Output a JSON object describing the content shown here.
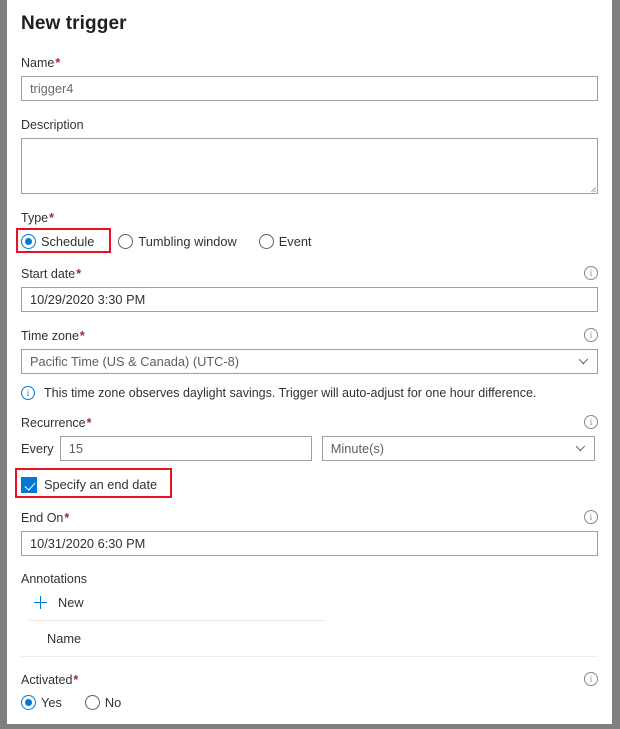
{
  "panel": {
    "title": "New trigger"
  },
  "fields": {
    "name": {
      "label": "Name",
      "required": "*",
      "value": "trigger4"
    },
    "description": {
      "label": "Description",
      "value": ""
    },
    "type": {
      "label": "Type",
      "required": "*",
      "options": [
        {
          "label": "Schedule",
          "selected": true,
          "highlighted": true
        },
        {
          "label": "Tumbling window",
          "selected": false,
          "highlighted": false
        },
        {
          "label": "Event",
          "selected": false,
          "highlighted": false
        }
      ]
    },
    "start_date": {
      "label": "Start date",
      "required": "*",
      "value": "10/29/2020 3:30 PM",
      "info_icon": "info-icon"
    },
    "time_zone": {
      "label": "Time zone",
      "required": "*",
      "value": "Pacific Time (US & Canada) (UTC-8)",
      "info_icon": "info-icon",
      "chevron": "chevron-down-icon",
      "note": "This time zone observes daylight savings. Trigger will auto-adjust for one hour difference."
    },
    "recurrence": {
      "label": "Recurrence",
      "required": "*",
      "info_icon": "info-icon",
      "every_word": "Every",
      "interval_value": "15",
      "unit_value": "Minute(s)",
      "chevron": "chevron-down-icon"
    },
    "specify_end_date": {
      "label": "Specify an end date",
      "checked": true,
      "highlighted": true
    },
    "end_on": {
      "label": "End On",
      "required": "*",
      "value": "10/31/2020 6:30 PM",
      "info_icon": "info-icon"
    },
    "annotations": {
      "label": "Annotations",
      "new_label": "New",
      "plus_icon": "plus-icon",
      "columns": [
        "Name"
      ],
      "rows": []
    },
    "activated": {
      "label": "Activated",
      "required": "*",
      "info_icon": "info-icon",
      "options": [
        {
          "label": "Yes",
          "selected": true
        },
        {
          "label": "No",
          "selected": false
        }
      ]
    }
  },
  "colors": {
    "accent": "#0078d4",
    "required": "#a4262c",
    "highlight": "#e81123",
    "border": "#a19f9d",
    "frame": "#7f7f7f"
  }
}
